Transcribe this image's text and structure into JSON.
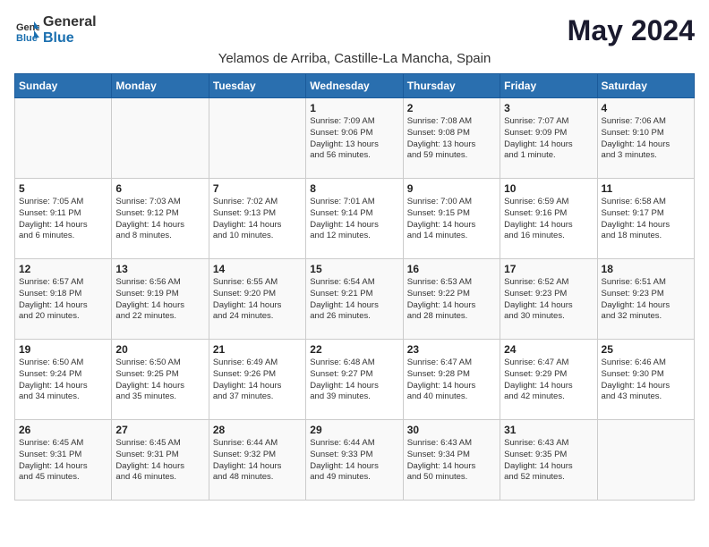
{
  "header": {
    "logo_general": "General",
    "logo_blue": "Blue",
    "month_title": "May 2024",
    "location": "Yelamos de Arriba, Castille-La Mancha, Spain"
  },
  "days_of_week": [
    "Sunday",
    "Monday",
    "Tuesday",
    "Wednesday",
    "Thursday",
    "Friday",
    "Saturday"
  ],
  "weeks": [
    [
      {
        "day": "",
        "content": ""
      },
      {
        "day": "",
        "content": ""
      },
      {
        "day": "",
        "content": ""
      },
      {
        "day": "1",
        "content": "Sunrise: 7:09 AM\nSunset: 9:06 PM\nDaylight: 13 hours\nand 56 minutes."
      },
      {
        "day": "2",
        "content": "Sunrise: 7:08 AM\nSunset: 9:08 PM\nDaylight: 13 hours\nand 59 minutes."
      },
      {
        "day": "3",
        "content": "Sunrise: 7:07 AM\nSunset: 9:09 PM\nDaylight: 14 hours\nand 1 minute."
      },
      {
        "day": "4",
        "content": "Sunrise: 7:06 AM\nSunset: 9:10 PM\nDaylight: 14 hours\nand 3 minutes."
      }
    ],
    [
      {
        "day": "5",
        "content": "Sunrise: 7:05 AM\nSunset: 9:11 PM\nDaylight: 14 hours\nand 6 minutes."
      },
      {
        "day": "6",
        "content": "Sunrise: 7:03 AM\nSunset: 9:12 PM\nDaylight: 14 hours\nand 8 minutes."
      },
      {
        "day": "7",
        "content": "Sunrise: 7:02 AM\nSunset: 9:13 PM\nDaylight: 14 hours\nand 10 minutes."
      },
      {
        "day": "8",
        "content": "Sunrise: 7:01 AM\nSunset: 9:14 PM\nDaylight: 14 hours\nand 12 minutes."
      },
      {
        "day": "9",
        "content": "Sunrise: 7:00 AM\nSunset: 9:15 PM\nDaylight: 14 hours\nand 14 minutes."
      },
      {
        "day": "10",
        "content": "Sunrise: 6:59 AM\nSunset: 9:16 PM\nDaylight: 14 hours\nand 16 minutes."
      },
      {
        "day": "11",
        "content": "Sunrise: 6:58 AM\nSunset: 9:17 PM\nDaylight: 14 hours\nand 18 minutes."
      }
    ],
    [
      {
        "day": "12",
        "content": "Sunrise: 6:57 AM\nSunset: 9:18 PM\nDaylight: 14 hours\nand 20 minutes."
      },
      {
        "day": "13",
        "content": "Sunrise: 6:56 AM\nSunset: 9:19 PM\nDaylight: 14 hours\nand 22 minutes."
      },
      {
        "day": "14",
        "content": "Sunrise: 6:55 AM\nSunset: 9:20 PM\nDaylight: 14 hours\nand 24 minutes."
      },
      {
        "day": "15",
        "content": "Sunrise: 6:54 AM\nSunset: 9:21 PM\nDaylight: 14 hours\nand 26 minutes."
      },
      {
        "day": "16",
        "content": "Sunrise: 6:53 AM\nSunset: 9:22 PM\nDaylight: 14 hours\nand 28 minutes."
      },
      {
        "day": "17",
        "content": "Sunrise: 6:52 AM\nSunset: 9:23 PM\nDaylight: 14 hours\nand 30 minutes."
      },
      {
        "day": "18",
        "content": "Sunrise: 6:51 AM\nSunset: 9:23 PM\nDaylight: 14 hours\nand 32 minutes."
      }
    ],
    [
      {
        "day": "19",
        "content": "Sunrise: 6:50 AM\nSunset: 9:24 PM\nDaylight: 14 hours\nand 34 minutes."
      },
      {
        "day": "20",
        "content": "Sunrise: 6:50 AM\nSunset: 9:25 PM\nDaylight: 14 hours\nand 35 minutes."
      },
      {
        "day": "21",
        "content": "Sunrise: 6:49 AM\nSunset: 9:26 PM\nDaylight: 14 hours\nand 37 minutes."
      },
      {
        "day": "22",
        "content": "Sunrise: 6:48 AM\nSunset: 9:27 PM\nDaylight: 14 hours\nand 39 minutes."
      },
      {
        "day": "23",
        "content": "Sunrise: 6:47 AM\nSunset: 9:28 PM\nDaylight: 14 hours\nand 40 minutes."
      },
      {
        "day": "24",
        "content": "Sunrise: 6:47 AM\nSunset: 9:29 PM\nDaylight: 14 hours\nand 42 minutes."
      },
      {
        "day": "25",
        "content": "Sunrise: 6:46 AM\nSunset: 9:30 PM\nDaylight: 14 hours\nand 43 minutes."
      }
    ],
    [
      {
        "day": "26",
        "content": "Sunrise: 6:45 AM\nSunset: 9:31 PM\nDaylight: 14 hours\nand 45 minutes."
      },
      {
        "day": "27",
        "content": "Sunrise: 6:45 AM\nSunset: 9:31 PM\nDaylight: 14 hours\nand 46 minutes."
      },
      {
        "day": "28",
        "content": "Sunrise: 6:44 AM\nSunset: 9:32 PM\nDaylight: 14 hours\nand 48 minutes."
      },
      {
        "day": "29",
        "content": "Sunrise: 6:44 AM\nSunset: 9:33 PM\nDaylight: 14 hours\nand 49 minutes."
      },
      {
        "day": "30",
        "content": "Sunrise: 6:43 AM\nSunset: 9:34 PM\nDaylight: 14 hours\nand 50 minutes."
      },
      {
        "day": "31",
        "content": "Sunrise: 6:43 AM\nSunset: 9:35 PM\nDaylight: 14 hours\nand 52 minutes."
      },
      {
        "day": "",
        "content": ""
      }
    ]
  ]
}
